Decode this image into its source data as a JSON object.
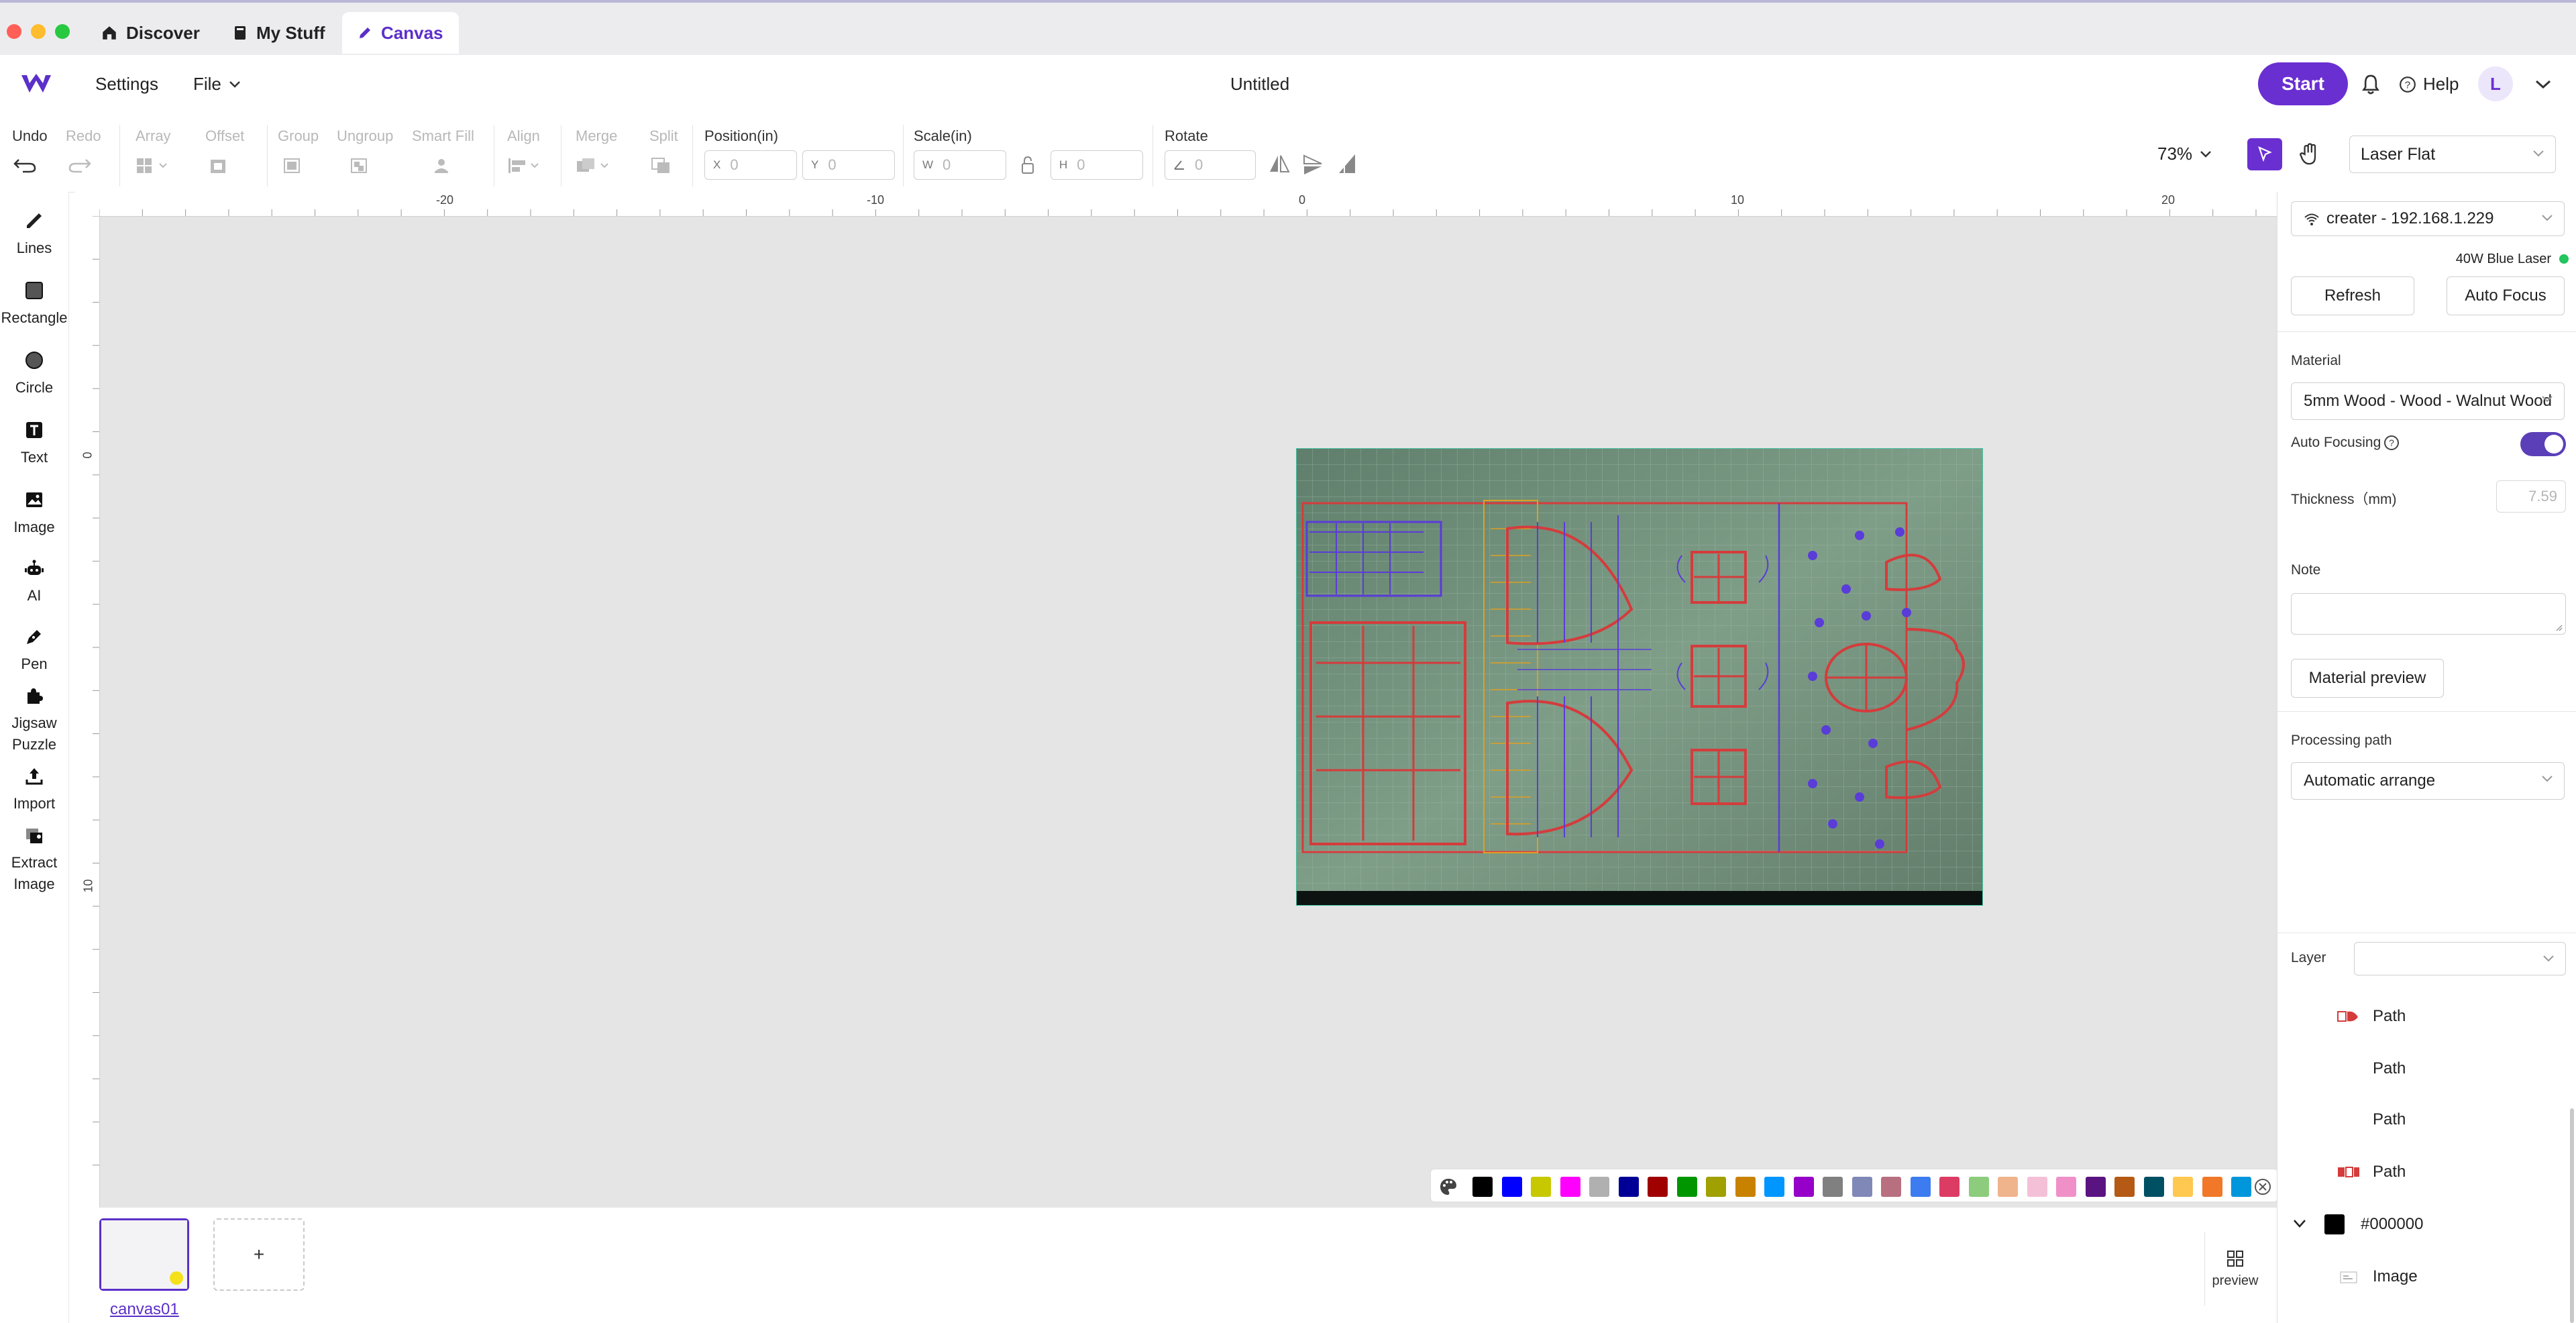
{
  "tabs": [
    {
      "label": "Discover",
      "icon": "home-icon"
    },
    {
      "label": "My Stuff",
      "icon": "book-icon"
    },
    {
      "label": "Canvas",
      "icon": "pencil-icon"
    }
  ],
  "header": {
    "settings": "Settings",
    "file": "File",
    "doc_title": "Untitled",
    "start": "Start",
    "help": "Help",
    "avatar": "L"
  },
  "toolbar": {
    "undo": "Undo",
    "redo": "Redo",
    "array": "Array",
    "offset": "Offset",
    "group": "Group",
    "ungroup": "Ungroup",
    "smart_fill": "Smart Fill",
    "align": "Align",
    "merge": "Merge",
    "split": "Split",
    "position": "Position(in)",
    "scale": "Scale(in)",
    "rotate": "Rotate",
    "x_prefix": "X",
    "y_prefix": "Y",
    "w_prefix": "W",
    "h_prefix": "H",
    "x_value": "0",
    "y_value": "0",
    "w_value": "0",
    "h_value": "0",
    "rotate_value": "0",
    "zoom": "73%",
    "mode": "Laser Flat"
  },
  "tools": [
    {
      "label": "Lines",
      "icon": "line-icon"
    },
    {
      "label": "Rectangle",
      "icon": "rectangle-icon"
    },
    {
      "label": "Circle",
      "icon": "circle-icon"
    },
    {
      "label": "Text",
      "icon": "text-icon"
    },
    {
      "label": "Image",
      "icon": "image-icon"
    },
    {
      "label": "AI",
      "icon": "robot-icon"
    },
    {
      "label": "Pen",
      "icon": "pen-icon"
    },
    {
      "label": "Jigsaw Puzzle",
      "icon": "puzzle-icon"
    },
    {
      "label": "Import",
      "icon": "import-icon"
    },
    {
      "label": "Extract Image",
      "icon": "extract-image-icon"
    }
  ],
  "ruler": {
    "top_labels": [
      "-20",
      "-10",
      "0",
      "10",
      "20"
    ],
    "left_labels": [
      "0",
      "10"
    ]
  },
  "palette": {
    "colors": [
      "#000000",
      "#0000ff",
      "#c8c800",
      "#ff00ff",
      "#b0b0b0",
      "#000096",
      "#a00000",
      "#009600",
      "#a0a000",
      "#c88200",
      "#0096ff",
      "#9600c8",
      "#808080",
      "#8088b8",
      "#b87080",
      "#3c7cf0",
      "#dc3c64",
      "#8ccc7c",
      "#f0b48c",
      "#f4c0d8",
      "#f090c8",
      "#5a1482",
      "#b45a14",
      "#005064",
      "#ffc850",
      "#f07828",
      "#0096dc"
    ]
  },
  "canvas": {
    "name": "canvas01",
    "add": "+",
    "preview": "preview"
  },
  "panel": {
    "device": "creater - 192.168.1.229",
    "laser": "40W Blue Laser",
    "status_color": "#22c55e",
    "refresh": "Refresh",
    "auto_focus": "Auto Focus",
    "material_label": "Material",
    "material": "5mm Wood - Wood - Walnut Wood",
    "auto_focusing": "Auto Focusing",
    "auto_focusing_on": true,
    "thickness_label": "Thickness（mm)",
    "thickness": "7.59",
    "note_label": "Note",
    "material_preview": "Material preview",
    "processing_label": "Processing path",
    "processing": "Automatic arrange",
    "layer_label": "Layer",
    "layers": [
      {
        "name": "Path"
      },
      {
        "name": "Path"
      },
      {
        "name": "Path"
      },
      {
        "name": "Path"
      }
    ],
    "group_color": "#000000",
    "group_name": "#000000",
    "group_child": "Image"
  },
  "colors": {
    "accent": "#6a2fd1",
    "toggle": "#5b3fb8"
  }
}
